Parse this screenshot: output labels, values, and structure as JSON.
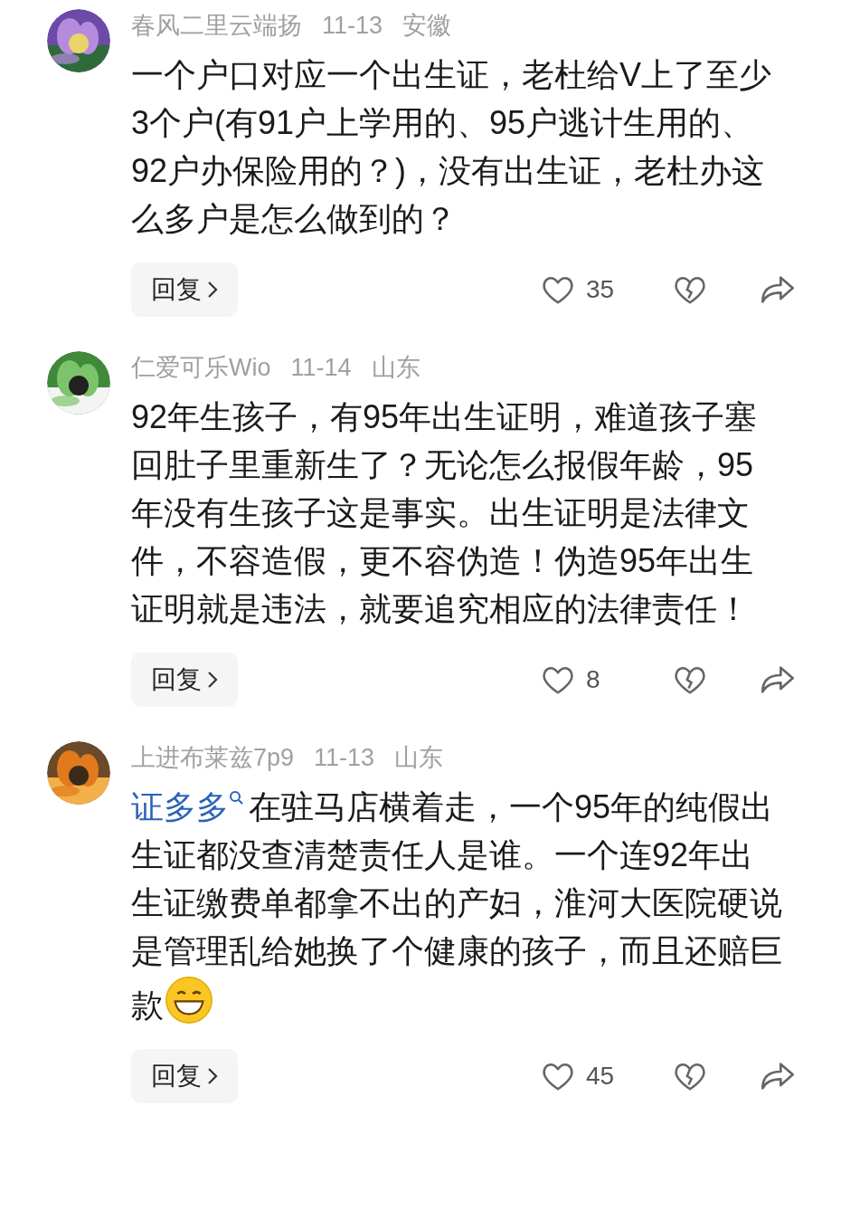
{
  "comments": [
    {
      "user": "春风二里云端扬",
      "date": "11-13",
      "region": "安徽",
      "text": "一个户口对应一个出生证，老杜给V上了至少3个户(有91户上学用的、95户逃计生用的、92户办保险用的？)，没有出生证，老杜办这么多户是怎么做到的？",
      "reply": "回复",
      "likes": "35"
    },
    {
      "user": "仁爱可乐Wio",
      "date": "11-14",
      "region": "山东",
      "text": "92年生孩子，有95年出生证明，难道孩子塞回肚子里重新生了？无论怎么报假年龄，95年没有生孩子这是事实。出生证明是法律文件，不容造假，更不容伪造！伪造95年出生证明就是违法，就要追究相应的法律责任！",
      "reply": "回复",
      "likes": "8"
    },
    {
      "user": "上进布莱兹7p9",
      "date": "11-13",
      "region": "山东",
      "mention": "证多多",
      "text": "在驻马店横着走，一个95年的纯假出生证都没查清楚责任人是谁。一个连92年出生证缴费单都拿不出的产妇，淮河大医院硬说是管理乱给她换了个健康的孩子，而且还赔巨款",
      "emoji": true,
      "reply": "回复",
      "likes": "45"
    }
  ]
}
